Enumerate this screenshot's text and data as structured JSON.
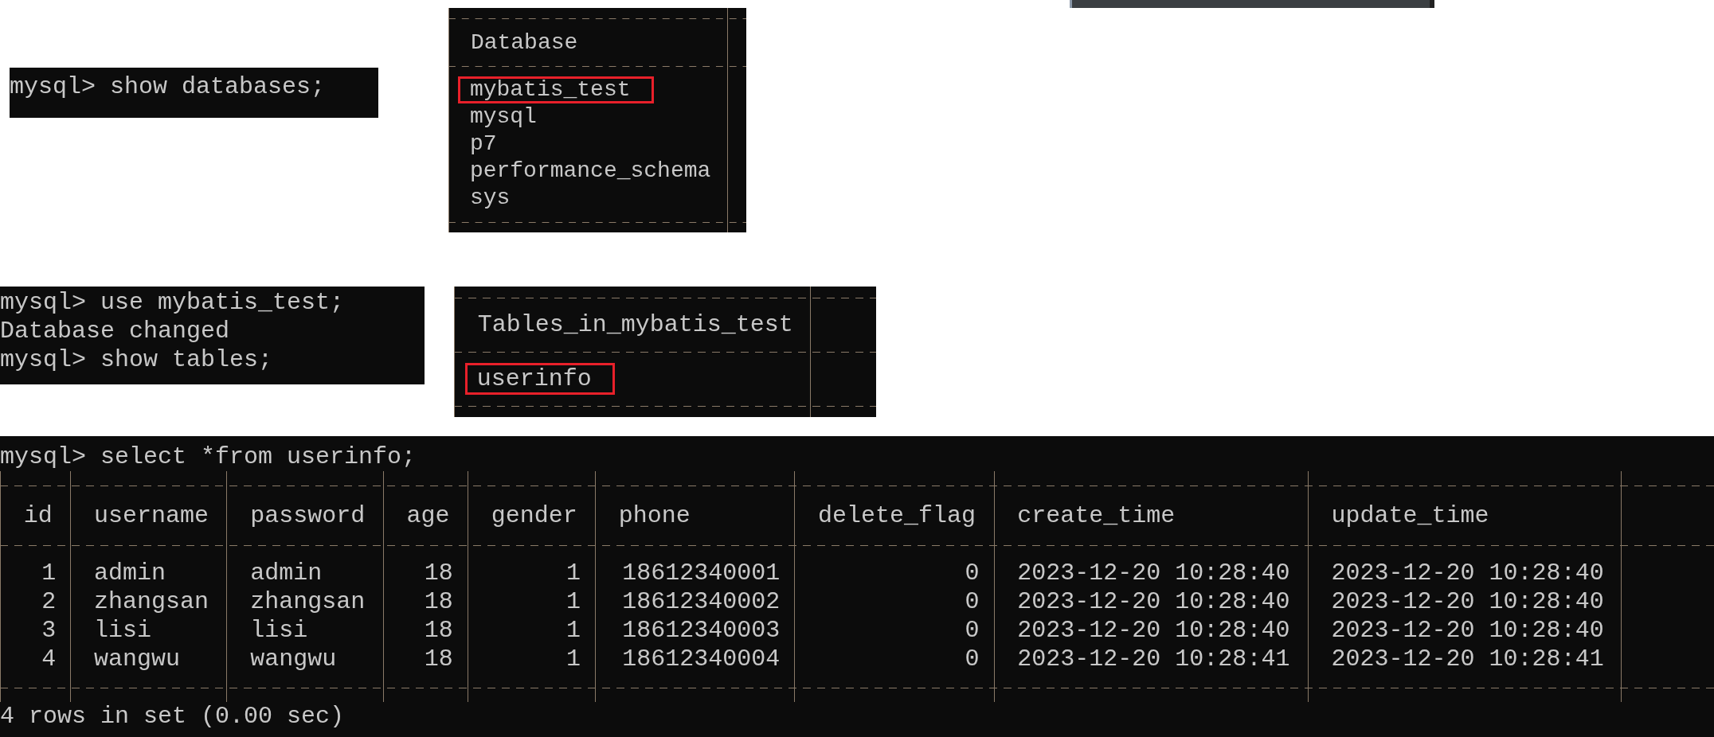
{
  "databases_query": {
    "lines": [
      "mysql> show databases;"
    ]
  },
  "databases_result": {
    "column": "Database",
    "rows": [
      {
        "value": "mybatis_test",
        "highlighted": true
      },
      {
        "value": "mysql",
        "highlighted": false
      },
      {
        "value": "p7",
        "highlighted": false
      },
      {
        "value": "performance_schema",
        "highlighted": false
      },
      {
        "value": "sys",
        "highlighted": false
      }
    ]
  },
  "tables_query": {
    "lines": [
      "mysql> use mybatis_test;",
      "Database changed",
      "mysql> show tables;"
    ]
  },
  "tables_result": {
    "column": "Tables_in_mybatis_test",
    "rows": [
      {
        "value": "userinfo",
        "highlighted": true
      }
    ]
  },
  "select_query": {
    "command": "mysql> select *from userinfo;"
  },
  "userinfo_table": {
    "columns": [
      "id",
      "username",
      "password",
      "age",
      "gender",
      "phone",
      "delete_flag",
      "create_time",
      "update_time"
    ],
    "rows": [
      [
        "1",
        "admin",
        "admin",
        "18",
        "1",
        "18612340001",
        "0",
        "2023-12-20 10:28:40",
        "2023-12-20 10:28:40"
      ],
      [
        "2",
        "zhangsan",
        "zhangsan",
        "18",
        "1",
        "18612340002",
        "0",
        "2023-12-20 10:28:40",
        "2023-12-20 10:28:40"
      ],
      [
        "3",
        "lisi",
        "lisi",
        "18",
        "1",
        "18612340003",
        "0",
        "2023-12-20 10:28:40",
        "2023-12-20 10:28:40"
      ],
      [
        "4",
        "wangwu",
        "wangwu",
        "18",
        "1",
        "18612340004",
        "0",
        "2023-12-20 10:28:41",
        "2023-12-20 10:28:41"
      ]
    ]
  },
  "result_summary": "4 rows in set (0.00 sec)"
}
